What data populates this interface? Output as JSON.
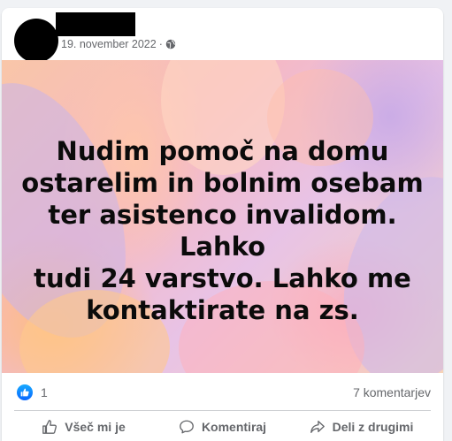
{
  "post": {
    "date": "19. november 2022",
    "separator": "·",
    "privacy_icon": "globe-icon",
    "text_lines": [
      "Nudim pomoč na domu",
      "ostarelim in bolnim osebam",
      "ter asistenco invalidom. Lahko",
      "tudi 24 varstvo. Lahko me",
      "kontaktirate na zs."
    ]
  },
  "stats": {
    "like_count": "1",
    "comments": "7 komentarjev"
  },
  "actions": {
    "like": "Všeč mi je",
    "comment": "Komentiraj",
    "share": "Deli z drugimi"
  },
  "colors": {
    "background": "#f0f2f5",
    "card": "#ffffff",
    "secondary_text": "#65676b",
    "like_blue": "#0866ff",
    "redaction": "#000000"
  }
}
